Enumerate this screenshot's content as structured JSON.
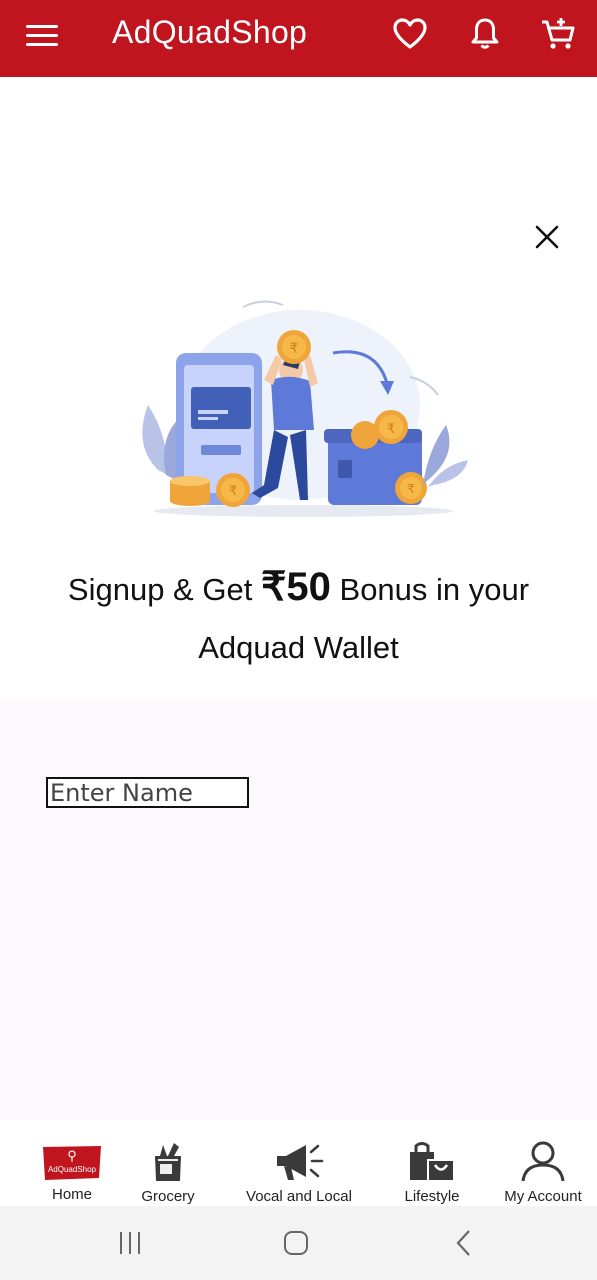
{
  "appbar": {
    "title": "AdQuadShop",
    "icons": [
      "menu-icon",
      "heart-icon",
      "bell-icon",
      "cart-icon"
    ],
    "color": "#c0141f"
  },
  "promo": {
    "headline_prefix": "Signup & Get",
    "amount": "₹50",
    "headline_suffix": "Bonus in your",
    "headline_line2": "Adquad Wallet"
  },
  "form": {
    "name_placeholder": "Enter Name",
    "name_value": ""
  },
  "bottom_nav": {
    "logo_text": "AdQuadShop",
    "items": [
      {
        "label": "Home",
        "icon": "adquadshop-logo-icon"
      },
      {
        "label": "Grocery",
        "icon": "grocery-bag-icon"
      },
      {
        "label": "Vocal and Local",
        "icon": "megaphone-icon"
      },
      {
        "label": "Lifestyle",
        "icon": "shopping-bags-icon"
      },
      {
        "label": "My Account",
        "icon": "user-icon"
      }
    ]
  },
  "system_nav": [
    "recents-icon",
    "home-icon",
    "back-icon"
  ]
}
